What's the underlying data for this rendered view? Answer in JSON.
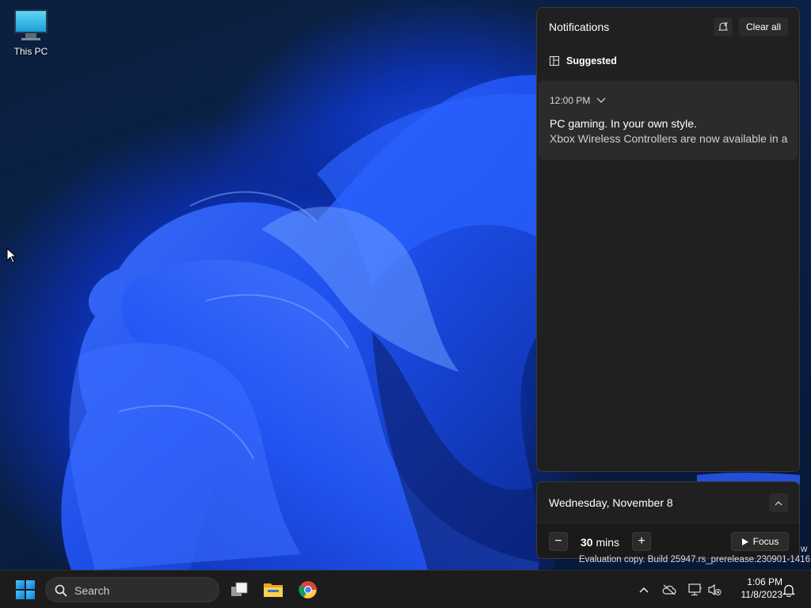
{
  "desktop": {
    "icons": [
      {
        "label": "This PC",
        "icon": "this-pc-icon"
      }
    ]
  },
  "notifications": {
    "title": "Notifications",
    "clear_all_label": "Clear all",
    "group_label": "Suggested",
    "items": [
      {
        "time": "12:00 PM",
        "title": "PC gaming. In your own style.",
        "body": "Xbox Wireless Controllers are now available in a"
      }
    ]
  },
  "calendar": {
    "date": "Wednesday, November 8",
    "focus": {
      "duration_value": "30",
      "duration_unit": "mins",
      "decrease_label": "−",
      "increase_label": "+",
      "focus_label": "Focus"
    }
  },
  "watermark": {
    "text": "Evaluation copy. Build 25947.rs_prerelease.230901-1416",
    "trailing": "w"
  },
  "taskbar": {
    "search_placeholder": "Search",
    "apps": [
      "task-view-icon",
      "file-explorer-icon",
      "chrome-icon"
    ],
    "tray_icons": [
      "chevron-up-icon",
      "cloud-off-icon",
      "network-icon",
      "volume-muted-icon"
    ],
    "time": "1:06 PM",
    "date": "11/8/2023",
    "notification_icon": "bell-icon"
  },
  "colors": {
    "accent": "#0a7fd8",
    "panel_bg": "#202020",
    "taskbar_bg": "#1c1c1c"
  }
}
